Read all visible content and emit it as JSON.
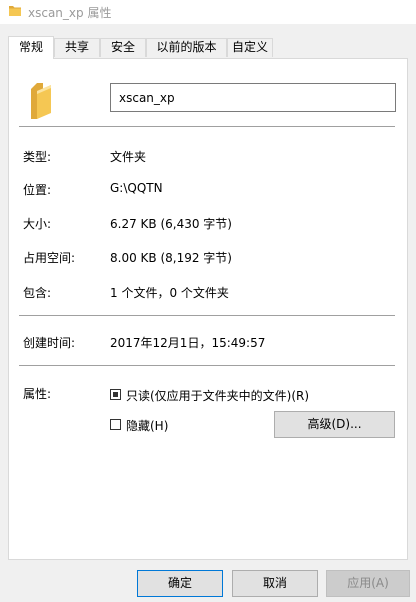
{
  "window": {
    "title": "xscan_xp 属性",
    "icon": "folder-icon"
  },
  "tabs": [
    {
      "label": "常规",
      "active": true
    },
    {
      "label": "共享",
      "active": false
    },
    {
      "label": "安全",
      "active": false
    },
    {
      "label": "以前的版本",
      "active": false
    },
    {
      "label": "自定义",
      "active": false
    }
  ],
  "general": {
    "folder_icon": "folder-icon",
    "name_value": "xscan_xp",
    "type_label": "类型:",
    "type_value": "文件夹",
    "location_label": "位置:",
    "location_value": "G:\\QQTN",
    "size_label": "大小:",
    "size_value": "6.27 KB (6,430 字节)",
    "disk_size_label": "占用空间:",
    "disk_size_value": "8.00 KB (8,192 字节)",
    "contains_label": "包含:",
    "contains_value": "1 个文件，0 个文件夹",
    "created_label": "创建时间:",
    "created_value": "2017年12月1日，15:49:57",
    "attributes_label": "属性:",
    "readonly_label": "只读(仅应用于文件夹中的文件)(R)",
    "readonly_state": "indeterminate",
    "hidden_label": "隐藏(H)",
    "hidden_checked": false,
    "advanced_button": "高级(D)..."
  },
  "footer": {
    "ok_button": "确定",
    "cancel_button": "取消",
    "apply_button": "应用(A)"
  },
  "colors": {
    "folder": "#f5c753",
    "folder_dark": "#e0a93a",
    "default_button_border": "#0078d7"
  }
}
